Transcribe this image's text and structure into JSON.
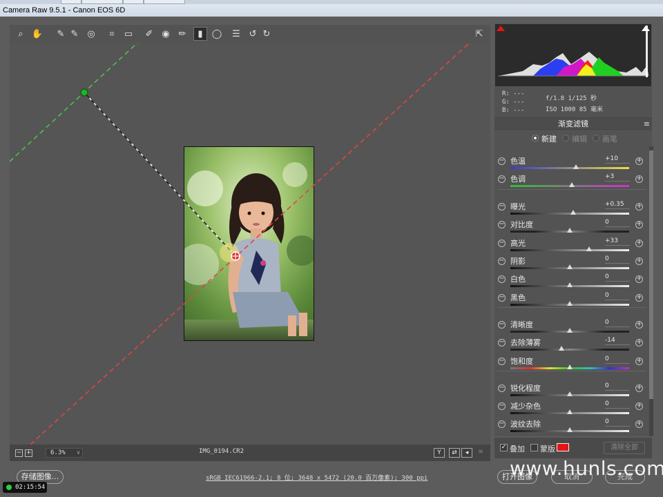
{
  "window": {
    "title": "Camera Raw 9.5.1 -  Canon EOS 6D"
  },
  "toolbar": {
    "tools": [
      {
        "name": "zoom-icon",
        "glyph": "⌕"
      },
      {
        "name": "hand-icon",
        "glyph": "✋"
      },
      {
        "name": "white-balance-icon",
        "glyph": "✎"
      },
      {
        "name": "color-sampler-icon",
        "glyph": "✎"
      },
      {
        "name": "targeted-adjustment-icon",
        "glyph": "◎"
      },
      {
        "name": "crop-icon",
        "glyph": "⌗"
      },
      {
        "name": "straighten-icon",
        "glyph": "▭"
      },
      {
        "name": "spot-removal-icon",
        "glyph": "✐"
      },
      {
        "name": "red-eye-icon",
        "glyph": "◉"
      },
      {
        "name": "adjustment-brush-icon",
        "glyph": "✏"
      },
      {
        "name": "graduated-filter-icon",
        "glyph": "▮"
      },
      {
        "name": "radial-filter-icon",
        "glyph": "◯"
      },
      {
        "name": "preferences-icon",
        "glyph": "☰"
      },
      {
        "name": "rotate-left-icon",
        "glyph": "↺"
      },
      {
        "name": "rotate-right-icon",
        "glyph": "↻"
      }
    ],
    "fullscreen_glyph": "⇱"
  },
  "canvas": {
    "zoom": "6.3%",
    "filename": "IMG_0194.CR2"
  },
  "readout": {
    "r": "R:  ---",
    "g": "G:  ---",
    "b": "B:  ---",
    "exif_line1": "f/1.8   1/125 秒",
    "exif_line2": "ISO 1000   85 毫米"
  },
  "panel": {
    "title": "渐变滤镜",
    "menu_glyph": "≡",
    "modes": {
      "new": "新建",
      "edit": "编辑",
      "brush": "画笔"
    }
  },
  "sliders": [
    {
      "label": "色温",
      "value": "+10",
      "pos": 0.55,
      "gradient": "linear-gradient(90deg,#3a3ad0,#e8e040)"
    },
    {
      "label": "色调",
      "value": "+3",
      "pos": 0.52,
      "gradient": "linear-gradient(90deg,#30c030,#d030d0)"
    },
    {
      "label": "曝光",
      "value": "+0.35",
      "pos": 0.53,
      "gradient": "linear-gradient(90deg,#111,#eee)"
    },
    {
      "label": "对比度",
      "value": "0",
      "pos": 0.5,
      "gradient": "linear-gradient(90deg,#222,#222 20%,#888 50%,#222 80%,#222)"
    },
    {
      "label": "高光",
      "value": "+33",
      "pos": 0.66,
      "gradient": "linear-gradient(90deg,#111,#eee)"
    },
    {
      "label": "阴影",
      "value": "0",
      "pos": 0.5,
      "gradient": "linear-gradient(90deg,#111,#eee)"
    },
    {
      "label": "白色",
      "value": "0",
      "pos": 0.5,
      "gradient": "linear-gradient(90deg,#111,#eee)"
    },
    {
      "label": "黑色",
      "value": "0",
      "pos": 0.5,
      "gradient": "linear-gradient(90deg,#111,#eee)"
    },
    {
      "label": "清晰度",
      "value": "0",
      "pos": 0.5,
      "gradient": "linear-gradient(90deg,#222,#222 20%,#888 50%,#222 80%,#222)"
    },
    {
      "label": "去除薄雾",
      "value": "-14",
      "pos": 0.43,
      "gradient": "linear-gradient(90deg,#222,#222 20%,#888 50%,#222 80%,#222)"
    },
    {
      "label": "饱和度",
      "value": "0",
      "pos": 0.5,
      "gradient": "linear-gradient(90deg,#777,#e03030,#e0e030,#30c030,#30c0c0,#3030e0,#c030c0)"
    },
    {
      "label": "锐化程度",
      "value": "0",
      "pos": 0.5,
      "gradient": "linear-gradient(90deg,#111,#eee)"
    },
    {
      "label": "减少杂色",
      "value": "0",
      "pos": 0.5,
      "gradient": "linear-gradient(90deg,#111,#eee)"
    },
    {
      "label": "波纹去除",
      "value": "0",
      "pos": 0.5,
      "gradient": "linear-gradient(90deg,#111,#eee)"
    }
  ],
  "bottom_panel": {
    "overlay_label": "叠加",
    "mask_label": "蒙版",
    "overlay_checked": true,
    "mask_color": "#e81414",
    "clear_all": "清除全部"
  },
  "footer": {
    "save_image": "存储图像...",
    "workflow": "sRGB IEC61966-2.1; 8 位; 3648 x 5472 (20.0 百万像素); 300 ppi",
    "open_image": "打开图像",
    "cancel": "取消",
    "done": "完成",
    "timer": "02:15:54",
    "watermark": "www.hunls.com"
  }
}
